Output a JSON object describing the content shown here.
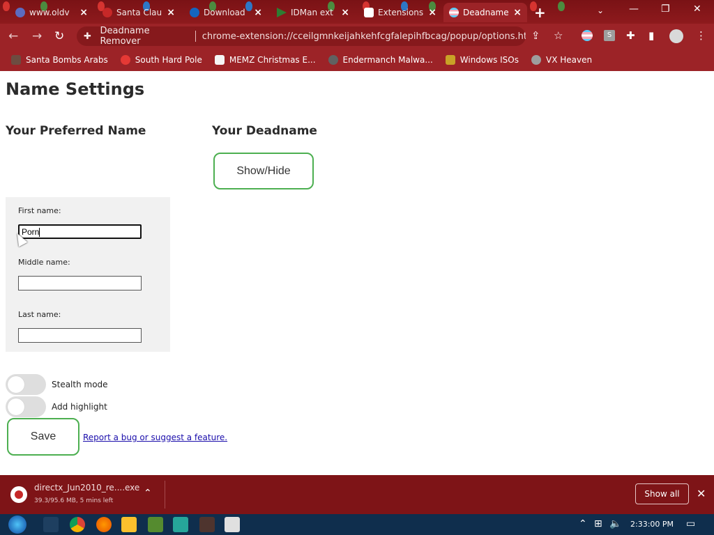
{
  "tabs": [
    {
      "title": "www.oldv",
      "close": "×"
    },
    {
      "title": "Santa Clau",
      "close": "×"
    },
    {
      "title": "Download",
      "close": "×"
    },
    {
      "title": "IDMan ext",
      "close": "×"
    },
    {
      "title": "Extensions",
      "close": "×"
    },
    {
      "title": "Deadname",
      "close": "×"
    }
  ],
  "tabstrip": {
    "new_tab": "+",
    "tab_search": "⌄"
  },
  "window_controls": {
    "minimize": "—",
    "restore": "❐",
    "close": "✕"
  },
  "toolbar": {
    "back": "←",
    "forward": "→",
    "reload": "↻",
    "site_name": "Deadname Remover",
    "url": "chrome-extension://cceilgmnkeijahkehfcgfalepihfbcag/popup/options.html",
    "share": "⇪",
    "bookmark_star": "☆",
    "extensions": "✚",
    "side_panel": "▮",
    "menu": "⋮",
    "ext_s": "S"
  },
  "bookmarks": [
    {
      "label": "Santa Bombs Arabs",
      "color": "#6d4c41"
    },
    {
      "label": "South Hard Pole",
      "color": "#e53935"
    },
    {
      "label": "MEMZ Christmas E...",
      "color": "#f5f5f5"
    },
    {
      "label": "Endermanch Malwa...",
      "color": "#616161"
    },
    {
      "label": "Windows ISOs",
      "color": "#c9a227"
    },
    {
      "label": "VX Heaven",
      "color": "#9e9e9e"
    }
  ],
  "page": {
    "title": "Name Settings",
    "preferred_heading": "Your Preferred Name",
    "deadname_heading": "Your Deadname",
    "show_hide_label": "Show/Hide",
    "first_name_label": "First name:",
    "first_name_value": "Porn",
    "middle_name_label": "Middle name:",
    "middle_name_value": "",
    "last_name_label": "Last name:",
    "last_name_value": "",
    "stealth_label": "Stealth mode",
    "stealth_on": false,
    "highlight_label": "Add highlight",
    "highlight_on": false,
    "save_label": "Save",
    "report_link": "Report a bug or suggest a feature."
  },
  "download": {
    "filename": "directx_Jun2010_re....exe",
    "status": "39.3/95.6 MB, 5 mins left",
    "show_all": "Show all",
    "close": "✕",
    "chevron": "⌃"
  },
  "taskbar": {
    "time": "2:33:00 PM",
    "tray_up": "⌃",
    "network": "⊞",
    "volume": "🔈",
    "notification": "▭"
  },
  "colors": {
    "chrome_frame": "#9c2327",
    "tabstrip": "#7a1215",
    "accent_green": "#4caf50",
    "link": "#1a0dab",
    "taskbar": "#0f2e4d"
  }
}
